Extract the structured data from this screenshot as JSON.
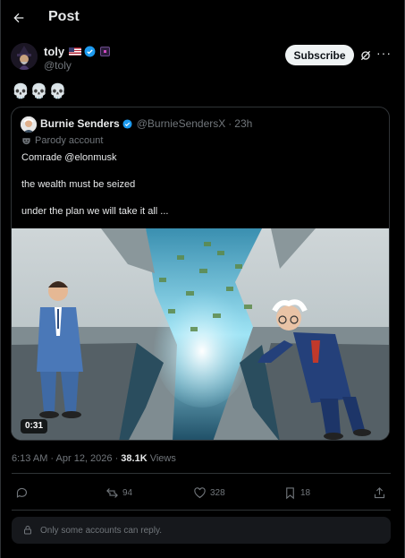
{
  "header": {
    "title": "Post"
  },
  "author": {
    "name": "toly",
    "handle": "@toly",
    "subscribe_label": "Subscribe"
  },
  "post": {
    "text": "💀💀💀"
  },
  "quote": {
    "name": "Burnie Senders",
    "handle": "@BurnieSendersX",
    "separator": "·",
    "time": "23h",
    "label": "Parody account",
    "lines": [
      "Comrade @elonmusk",
      "the wealth must be seized",
      "under the plan we will take it all  ..."
    ],
    "video_duration": "0:31"
  },
  "meta": {
    "timestamp": "6:13 AM · Apr 12, 2026 · ",
    "views_count": "38.1K",
    "views_label": " Views"
  },
  "actions": {
    "reposts": "94",
    "likes": "328",
    "bookmarks": "18"
  },
  "reply_restriction": "Only some accounts can reply.",
  "icons": [
    "back-arrow-icon",
    "verified-badge-icon",
    "us-flag-icon",
    "affiliate-badge-icon",
    "grok-icon",
    "more-icon",
    "parody-mask-icon",
    "reply-icon",
    "repost-icon",
    "like-icon",
    "bookmark-icon",
    "share-icon",
    "lock-icon"
  ],
  "colors": {
    "accent": "#1d9bf0",
    "background": "#000000",
    "text": "#e7e9ea",
    "muted": "#71767b",
    "border": "#2f3336"
  }
}
